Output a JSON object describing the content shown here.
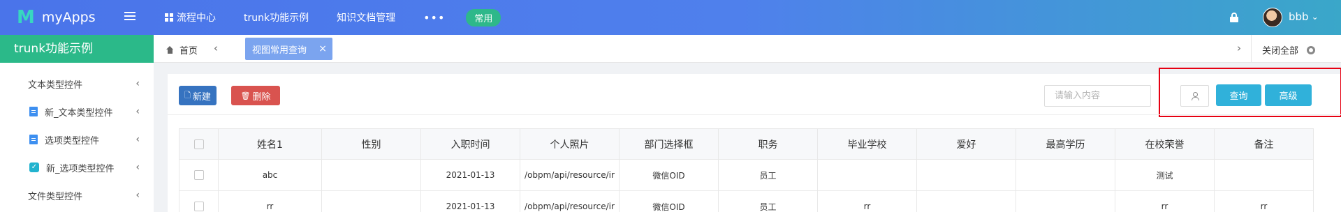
{
  "app": {
    "name": "myApps",
    "logo_mark": "M"
  },
  "topnav": {
    "items": [
      "流程中心",
      "trunk功能示例",
      "知识文档管理"
    ],
    "more": "•••",
    "pill": "常用"
  },
  "user": {
    "name": "bbb",
    "chevron": "⌄"
  },
  "sidebar": {
    "title": "trunk功能示例",
    "items": [
      {
        "label": "文本类型控件",
        "icon": ""
      },
      {
        "label": "新_文本类型控件",
        "icon": "document-icon"
      },
      {
        "label": "选项类型控件",
        "icon": "document-icon"
      },
      {
        "label": "新_选项类型控件",
        "icon": "checkbox-icon"
      },
      {
        "label": "文件类型控件",
        "icon": ""
      }
    ]
  },
  "tabs": {
    "home": "首页",
    "active": "视图常用查询",
    "close_all": "关闭全部",
    "close_glyph": "×",
    "prev": "‹",
    "next": "›"
  },
  "toolbar": {
    "new_label": "新建",
    "delete_label": "删除",
    "search_placeholder": "请输入内容",
    "query_label": "查询",
    "advanced_label": "高级"
  },
  "table": {
    "columns": [
      "姓名1",
      "性别",
      "入职时间",
      "个人照片",
      "部门选择框",
      "职务",
      "毕业学校",
      "爱好",
      "最高学历",
      "在校荣誉",
      "备注"
    ],
    "rows": [
      [
        "abc",
        "",
        "2021-01-13",
        "/obpm/api/resource/ir",
        "微信OID",
        "员工",
        "",
        "",
        "",
        "测试",
        ""
      ],
      [
        "rr",
        "",
        "2021-01-13",
        "/obpm/api/resource/ir",
        "微信OID",
        "员工",
        "rr",
        "",
        "",
        "rr",
        "rr"
      ]
    ]
  },
  "colors": {
    "topbar_start": "#4a74ea",
    "topbar_end": "#3aa7c9",
    "sidebar_header": "#2bb989",
    "active_tab": "#7ba4ef",
    "new_button": "#3673c0",
    "delete_button": "#d9534f",
    "query_button": "#30b1da",
    "highlight_box": "#e60012"
  }
}
